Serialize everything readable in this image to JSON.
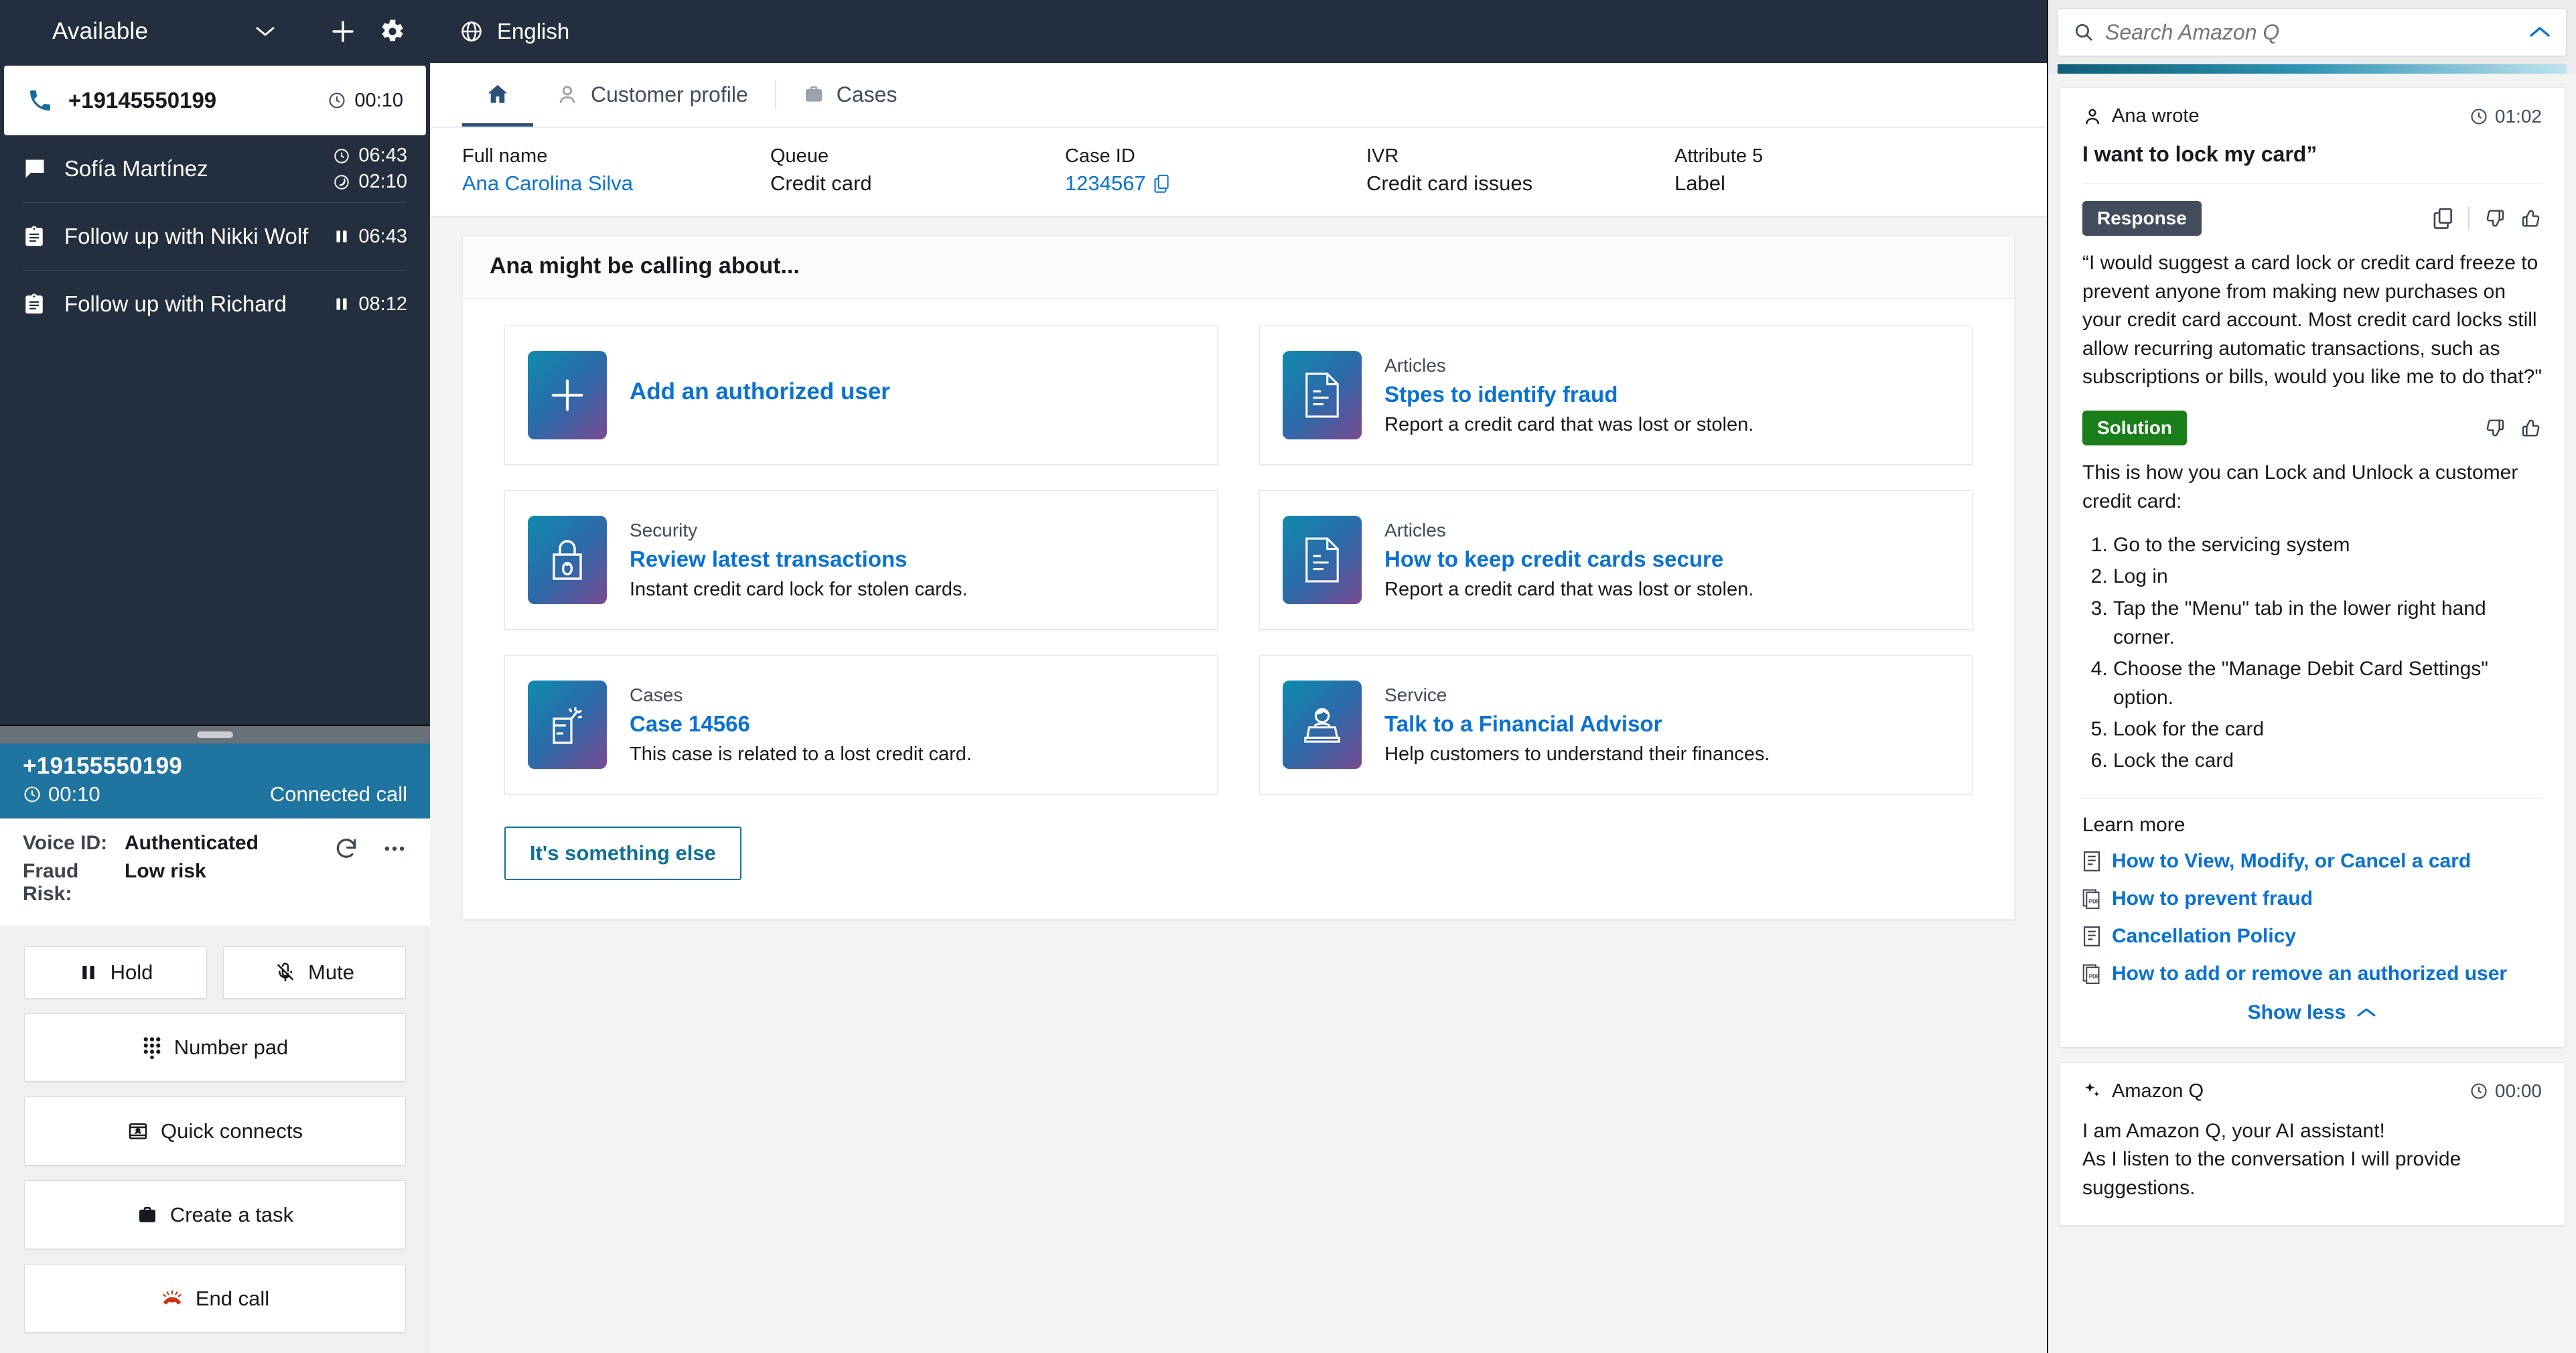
{
  "ccp": {
    "status": {
      "label": "Available",
      "icon": "chevron-down-icon"
    },
    "add_icon": "plus-icon",
    "settings_icon": "gear-icon",
    "contacts": [
      {
        "icon": "phone-icon",
        "name": "+19145550199",
        "time1": "00:10",
        "time1_icon": "clock-icon",
        "time2": "",
        "time2_icon": "",
        "active": true
      },
      {
        "icon": "chat-icon",
        "name": "Sofía Martínez",
        "time1": "06:43",
        "time1_icon": "clock-icon",
        "time2": "02:10",
        "time2_icon": "moon-clock-icon",
        "active": false
      },
      {
        "icon": "task-icon",
        "name": "Follow up with Nikki Wolf",
        "time1": "06:43",
        "time1_icon": "pause-icon",
        "time2": "",
        "time2_icon": "",
        "active": false
      },
      {
        "icon": "task-icon",
        "name": "Follow up with Richard",
        "time1": "08:12",
        "time1_icon": "pause-icon",
        "time2": "",
        "time2_icon": "",
        "active": false
      }
    ],
    "call": {
      "number": "+19155550199",
      "timer": "00:10",
      "state": "Connected call",
      "voice_id_key": "Voice ID:",
      "voice_id_value": "Authenticated",
      "fraud_key": "Fraud Risk:",
      "fraud_value": "Low risk",
      "refresh_icon": "refresh-icon",
      "more_icon": "ellipsis-icon"
    },
    "controls": [
      {
        "label": "Hold",
        "icon": "pause-icon"
      },
      {
        "label": "Mute",
        "icon": "mic-muted-icon"
      },
      {
        "label": "Number pad",
        "icon": "dialpad-icon"
      },
      {
        "label": "Quick connects",
        "icon": "contact-card-icon"
      },
      {
        "label": "Create a task",
        "icon": "briefcase-icon"
      },
      {
        "label": "End call",
        "icon": "end-call-icon"
      }
    ]
  },
  "topbar": {
    "language": "English",
    "globe_icon": "globe-icon"
  },
  "tabs": [
    {
      "label": "",
      "icon": "home-icon",
      "active": true
    },
    {
      "label": "Customer profile",
      "icon": "person-icon",
      "active": false
    },
    {
      "label": "Cases",
      "icon": "briefcase-icon",
      "active": false
    }
  ],
  "attributes": [
    {
      "label": "Full name",
      "value": "Ana Carolina Silva",
      "link": true,
      "copy": false
    },
    {
      "label": "Queue",
      "value": "Credit card",
      "link": false,
      "copy": false
    },
    {
      "label": "Case ID",
      "value": "1234567",
      "link": true,
      "copy": true,
      "copy_icon": "copy-icon"
    },
    {
      "label": "IVR",
      "value": "Credit card issues",
      "link": false,
      "copy": false
    },
    {
      "label": "Attribute 5",
      "value": "Label",
      "link": false,
      "copy": false
    }
  ],
  "suggestions": {
    "heading": "Ana might be calling about...",
    "cards": [
      {
        "category": "",
        "title": "Add an authorized user",
        "description": "",
        "icon": "plus-icon"
      },
      {
        "category": "Articles",
        "title": "Stpes to identify fraud",
        "description": "Report a credit card that was lost or stolen.",
        "icon": "document-icon"
      },
      {
        "category": "Security",
        "title": "Review latest transactions",
        "description": "Instant credit card lock for stolen cards.",
        "icon": "padlock-icon"
      },
      {
        "category": "Articles",
        "title": "How to keep credit cards secure",
        "description": "Report a credit card that was lost or stolen.",
        "icon": "document-icon"
      },
      {
        "category": "Cases",
        "title": "Case 14566",
        "description": "This case is related to a lost credit card.",
        "icon": "broken-card-icon"
      },
      {
        "category": "Service",
        "title": "Talk to a Financial Advisor",
        "description": "Help customers to understand their finances.",
        "icon": "advisor-icon"
      }
    ],
    "else_button": "It's something else"
  },
  "q": {
    "search": {
      "placeholder": "Search Amazon Q",
      "value": "",
      "search_icon": "search-icon",
      "collapse_icon": "chevron-up-icon"
    },
    "conversation": {
      "author": "Ana wrote",
      "author_icon": "person-icon",
      "time": "01:02",
      "time_icon": "clock-icon",
      "quote": "I want to lock my card”",
      "response_badge": "Response",
      "response_actions": {
        "copy_icon": "copy-icon",
        "thumbs_down_icon": "thumbs-down-icon",
        "thumbs_up_icon": "thumbs-up-icon"
      },
      "response_text": "“I would suggest a card lock or credit card freeze to prevent anyone from making new purchases on your credit card account. Most credit card locks still allow recurring automatic transactions, such as subscriptions or bills, would you like me to do that?\"",
      "solution_badge": "Solution",
      "solution_intro": "This is how you can Lock and Unlock a customer credit card:",
      "solution_steps": [
        "Go to the servicing system",
        "Log in",
        "Tap the \"Menu\" tab in the lower right hand corner.",
        "Choose the \"Manage Debit Card Settings\" option.",
        "Look for the card",
        "Lock the card"
      ],
      "learn_more_title": "Learn more",
      "learn_more_links": [
        {
          "label": "How to View, Modify, or Cancel a card",
          "icon": "article-icon"
        },
        {
          "label": "How to prevent fraud",
          "icon": "pdf-icon"
        },
        {
          "label": "Cancellation Policy",
          "icon": "article-icon"
        },
        {
          "label": "How to add or remove an authorized user",
          "icon": "pdf-icon"
        }
      ],
      "show_less": "Show less",
      "show_less_icon": "chevron-up-icon"
    },
    "footer_card": {
      "author": "Amazon Q",
      "author_icon": "sparkle-icon",
      "time": "00:00",
      "time_icon": "clock-icon",
      "line1": "I am Amazon Q, your AI assistant!",
      "line2": "As I listen to the conversation I will provide suggestions."
    }
  },
  "colors": {
    "navy": "#232f3e",
    "call_blue": "#2074a0",
    "link_blue": "#0972d3",
    "solution_green": "#1a7f1a",
    "response_gray": "#414d5c",
    "end_call_red": "#d13212"
  }
}
